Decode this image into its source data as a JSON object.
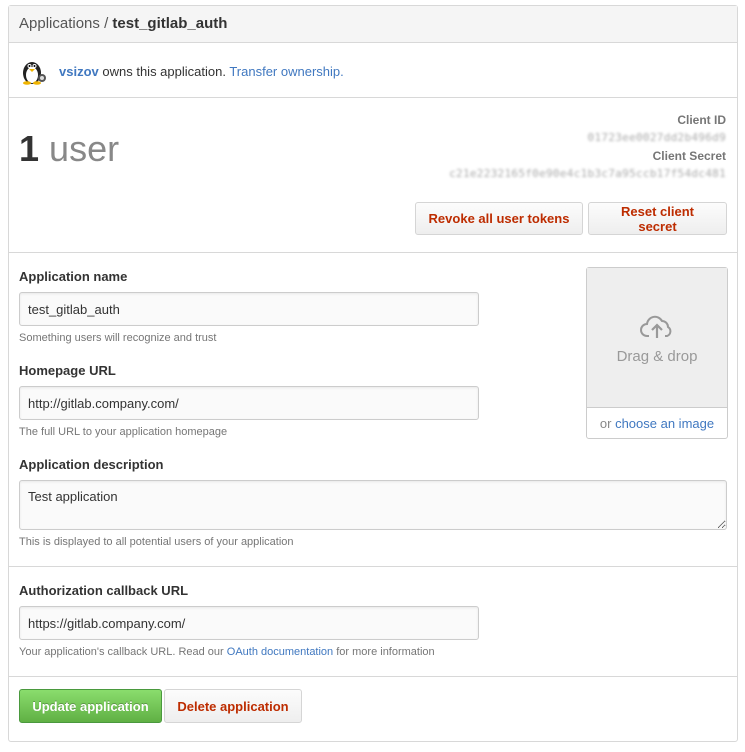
{
  "breadcrumb": {
    "parent": "Applications",
    "separator": "/",
    "current": "test_gitlab_auth"
  },
  "owner": {
    "username": "vsizov",
    "owns_text": "owns this application.",
    "transfer_link": "Transfer ownership."
  },
  "stats": {
    "user_count": "1",
    "user_label": "user",
    "client_id_label": "Client ID",
    "client_id_value": "01723ee0027dd2b496d9",
    "client_secret_label": "Client Secret",
    "client_secret_value": "c21e2232165f0e90e4c1b3c7a95ccb17f54dc481",
    "revoke_button": "Revoke all user tokens",
    "reset_button": "Reset client secret"
  },
  "form": {
    "app_name_label": "Application name",
    "app_name_value": "test_gitlab_auth",
    "app_name_note": "Something users will recognize and trust",
    "homepage_label": "Homepage URL",
    "homepage_value": "http://gitlab.company.com/",
    "homepage_note": "The full URL to your application homepage",
    "description_label": "Application description",
    "description_value": "Test application",
    "description_note": "This is displayed to all potential users of your application",
    "callback_label": "Authorization callback URL",
    "callback_value": "https://gitlab.company.com/",
    "callback_note_pre": "Your application's callback URL. Read our",
    "callback_note_link": "OAuth documentation",
    "callback_note_post": "for more information"
  },
  "logo_upload": {
    "drop_text": "Drag & drop",
    "or_text": "or",
    "choose_link": "choose an image",
    "icon": "cloud-upload-icon"
  },
  "actions": {
    "update_button": "Update application",
    "delete_button": "Delete application"
  },
  "colors": {
    "link": "#4078c0",
    "danger": "#bd2c00",
    "primary_green": "#60b044"
  }
}
